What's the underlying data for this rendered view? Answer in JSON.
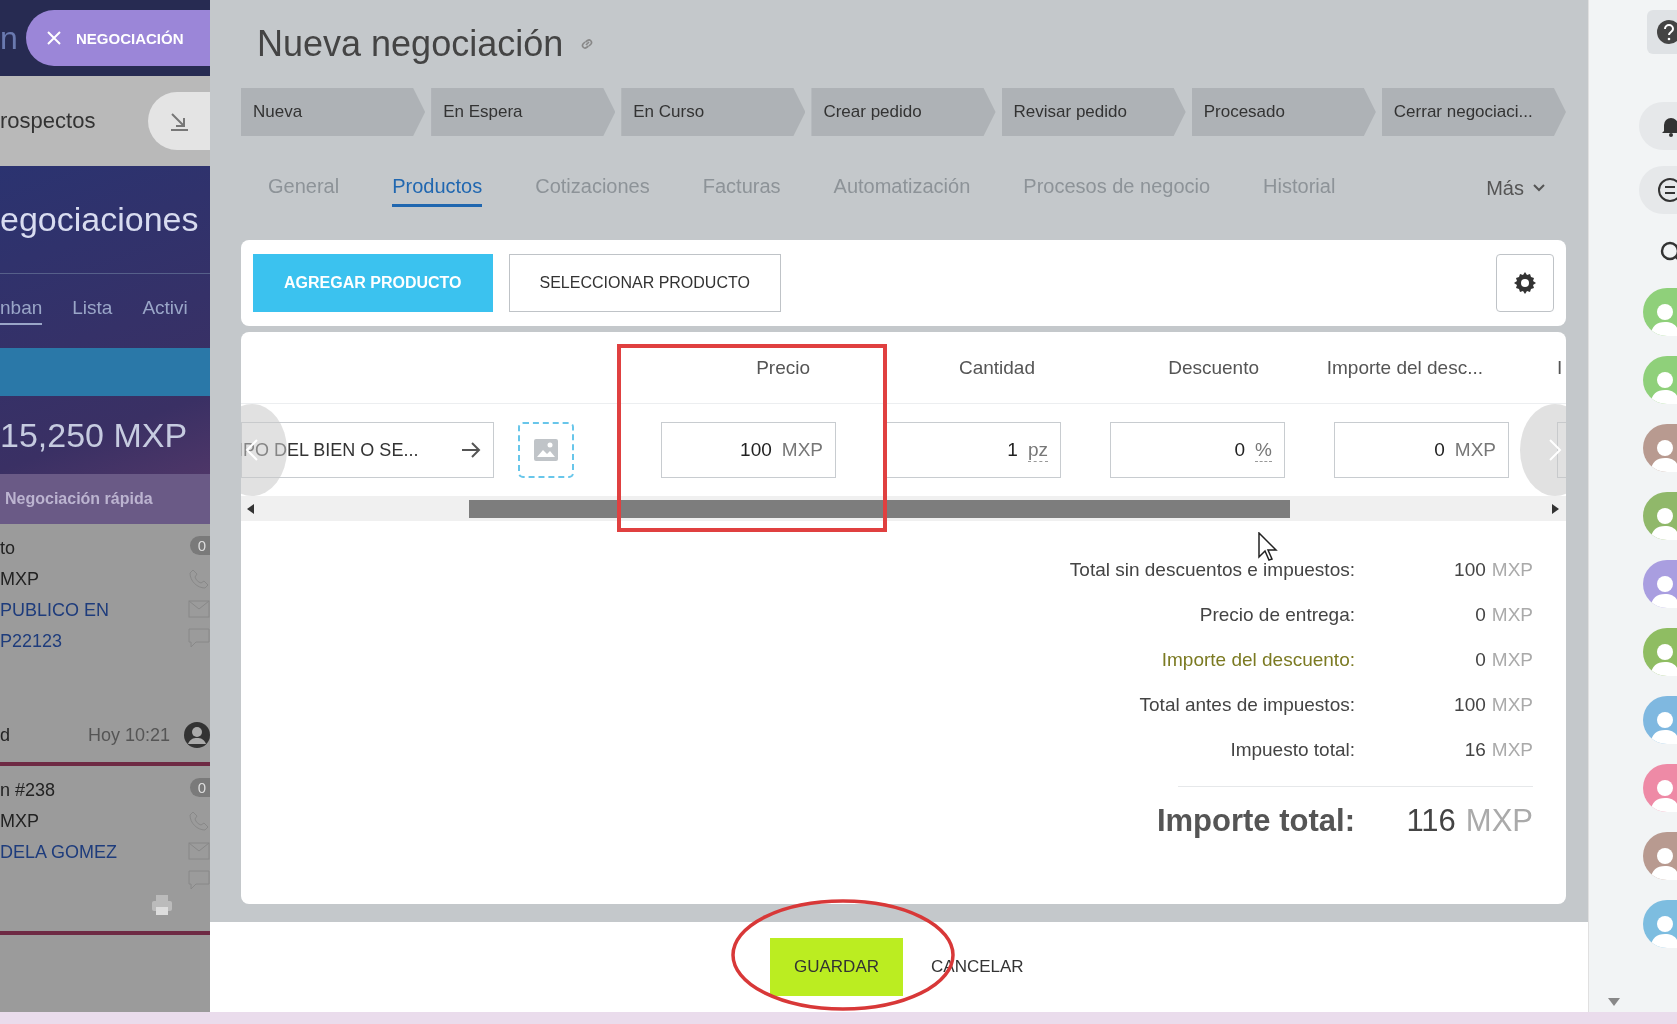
{
  "left_panel": {
    "top_text": "n",
    "badge": "NEGOCIACIÓN",
    "section": "rospectos",
    "heading": "egociaciones",
    "view_tabs": [
      {
        "label": "nban",
        "selected": true
      },
      {
        "label": "Lista",
        "selected": false
      },
      {
        "label": "Activi",
        "selected": false
      }
    ],
    "sum": "15,250 MXP",
    "quick": "Negociación rápida",
    "deals": [
      {
        "lines": [
          "to",
          "MXP"
        ],
        "client": [
          "PUBLICO EN",
          "P22123"
        ],
        "owner": "d",
        "time": "Hoy 10:21",
        "count": "0"
      },
      {
        "lines": [
          "n #238",
          "MXP"
        ],
        "client": [
          "DELA GOMEZ"
        ],
        "count": "0"
      }
    ]
  },
  "title": "Nueva negociación",
  "stages": [
    "Nueva",
    "En Espera",
    "En Curso",
    "Crear pedido",
    "Revisar pedido",
    "Procesado",
    "Cerrar negociaci..."
  ],
  "tabs": [
    {
      "label": "General",
      "selected": false
    },
    {
      "label": "Productos",
      "selected": true
    },
    {
      "label": "Cotizaciones",
      "selected": false
    },
    {
      "label": "Facturas",
      "selected": false
    },
    {
      "label": "Automatización",
      "selected": false
    },
    {
      "label": "Procesos de negocio",
      "selected": false
    },
    {
      "label": "Historial",
      "selected": false
    }
  ],
  "more_tab": "Más",
  "toolbar": {
    "add_button": "AGREGAR PRODUCTO",
    "select_button": "SELECCIONAR PRODUCTO"
  },
  "table": {
    "columns": [
      "Precio",
      "Cantidad",
      "Descuento",
      "Importe del desc...",
      "I"
    ],
    "product": "IPO DEL BIEN O SE...",
    "cells": [
      {
        "value": "100",
        "unit": "MXP"
      },
      {
        "value": "1",
        "unit": "pz"
      },
      {
        "value": "0",
        "unit": "%"
      },
      {
        "value": "0",
        "unit": "MXP"
      }
    ]
  },
  "totals": [
    {
      "label": "Total sin descuentos e impuestos:",
      "value": "100",
      "unit": "MXP",
      "kind": "plain"
    },
    {
      "label": "Precio de entrega:",
      "value": "0",
      "unit": "MXP",
      "kind": "plain"
    },
    {
      "label": "Importe del descuento:",
      "value": "0",
      "unit": "MXP",
      "kind": "discount"
    },
    {
      "label": "Total antes de impuestos:",
      "value": "100",
      "unit": "MXP",
      "kind": "plain"
    },
    {
      "label": "Impuesto total:",
      "value": "16",
      "unit": "MXP",
      "kind": "plain"
    }
  ],
  "grand_total": {
    "label": "Importe total:",
    "value": "116",
    "unit": "MXP"
  },
  "footer": {
    "save": "GUARDAR",
    "cancel": "CANCELAR"
  },
  "right_sidebar": {
    "avatars": [
      {
        "color": "#8fd07a"
      },
      {
        "color": "#8fd07a"
      },
      {
        "color": "#b89a90"
      },
      {
        "color": "#90b86a"
      },
      {
        "color": "#a99ee0"
      },
      {
        "color": "#8fbd62"
      },
      {
        "color": "#7fb8e0"
      },
      {
        "color": "#ee8aa6"
      },
      {
        "color": "#b89a90"
      },
      {
        "color": "#7dbde0"
      }
    ]
  }
}
